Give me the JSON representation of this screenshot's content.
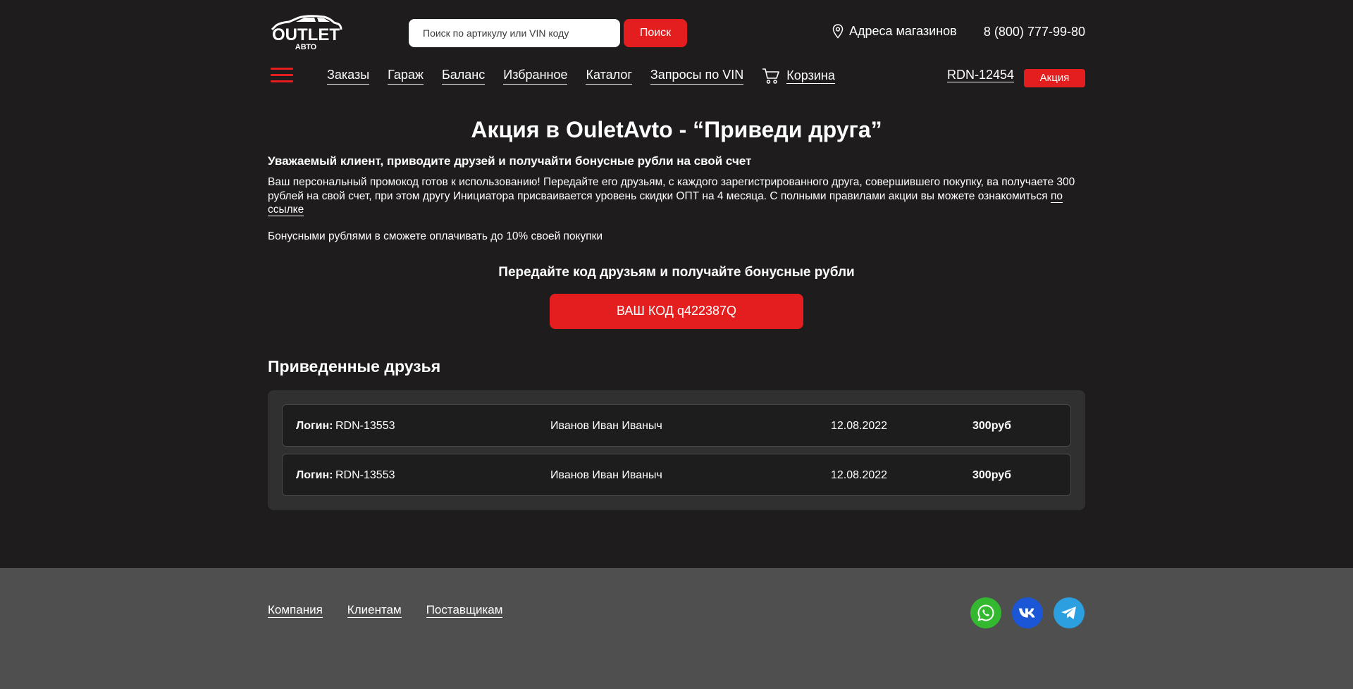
{
  "header": {
    "logo_top": "OUTLET",
    "logo_bottom": "АВТО",
    "search_placeholder": "Поиск по артикулу или VIN коду",
    "search_button": "Поиск",
    "stores_link": "Адреса магазинов",
    "phone": "8 (800) 777-99-80"
  },
  "nav": {
    "items": [
      "Заказы",
      "Гараж",
      "Баланс",
      "Избранное",
      "Каталог",
      "Запросы по VIN"
    ],
    "cart": "Корзина",
    "user_login": "RDN-12454",
    "promo_badge": "Акция"
  },
  "main": {
    "title": "Акция в OuletAvto - “Приведи друга”",
    "lead": "Уважаемый клиент, приводите друзей и получайти бонусные рубли на свой счет",
    "paragraph": "Ваш персональный промокод готов к использованию! Передайте его друзьям, с каждого зарегистрированного друга, совершившего покупку, ва получаете 300 рублей на свой счет, при этом другу Инициатора присваивается уровень скидки ОПТ на 4 месяца. С полными правилами акции вы можете ознакомиться",
    "paragraph_link": "по ссылке",
    "bonus_note": "Бонусными рублями в сможете оплачивать до 10% своей покупки",
    "share_title": "Передайте код друзьям и получайте бонусные рубли",
    "code_button": "ВАШ КОД q422387Q",
    "friends_title": "Приведенные друзья",
    "login_label": "Логин:",
    "friends": [
      {
        "login": "RDN-13553",
        "name": "Иванов Иван Иваныч",
        "date": "12.08.2022",
        "amount": "300руб"
      },
      {
        "login": "RDN-13553",
        "name": "Иванов Иван Иваныч",
        "date": "12.08.2022",
        "amount": "300руб"
      }
    ]
  },
  "footer": {
    "links": [
      "Компания",
      "Клиентам",
      "Поставщикам"
    ],
    "socials": [
      {
        "icon": "whatsapp-icon",
        "color": "#33b82f"
      },
      {
        "icon": "vk-icon",
        "color": "#1a56d6"
      },
      {
        "icon": "telegram-icon",
        "color": "#2c9fe0"
      }
    ]
  },
  "colors": {
    "background": "#1e1c1d",
    "accent": "#e41e1e",
    "panel": "#303030",
    "footer": "#4f4f4f"
  }
}
